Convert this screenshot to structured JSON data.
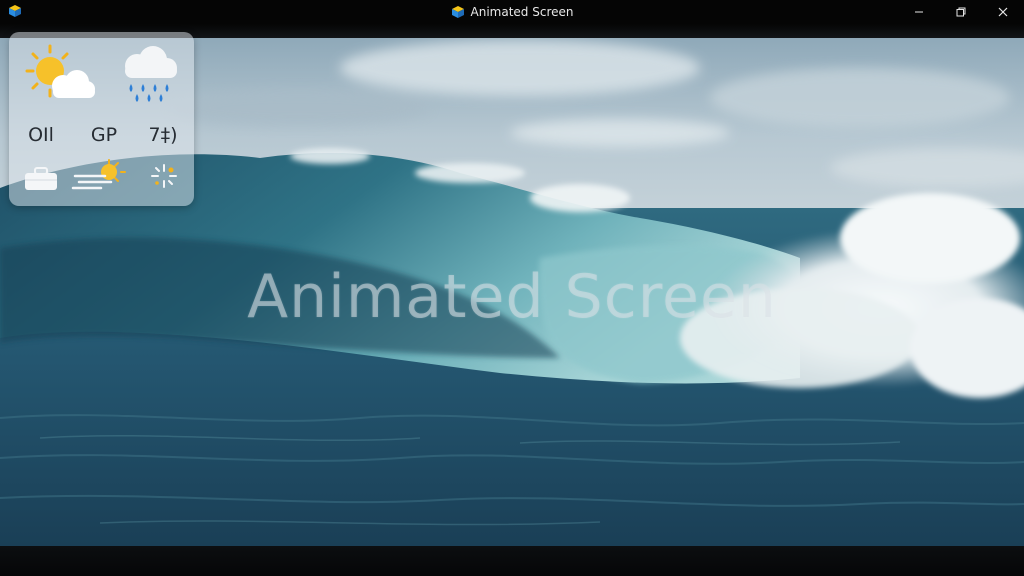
{
  "window": {
    "title": "Animated Screen",
    "controls": [
      "minimize",
      "restore",
      "close"
    ]
  },
  "watermark": {
    "text": "Animated Screen"
  },
  "widget": {
    "icons_top": [
      "partly-sunny-icon",
      "rain-cloud-icon"
    ],
    "labels": [
      "OIl",
      "GP",
      "7‡)"
    ],
    "icons_bottom": [
      "briefcase-icon",
      "windy-sun-icon",
      "sparkle-icon"
    ]
  },
  "colors": {
    "titlebar": "#050505",
    "sea_deep": "#1f4a62",
    "sea_wave": "#3e7f8f",
    "foam": "#eef3f4",
    "sky": "#b6c7d2"
  }
}
